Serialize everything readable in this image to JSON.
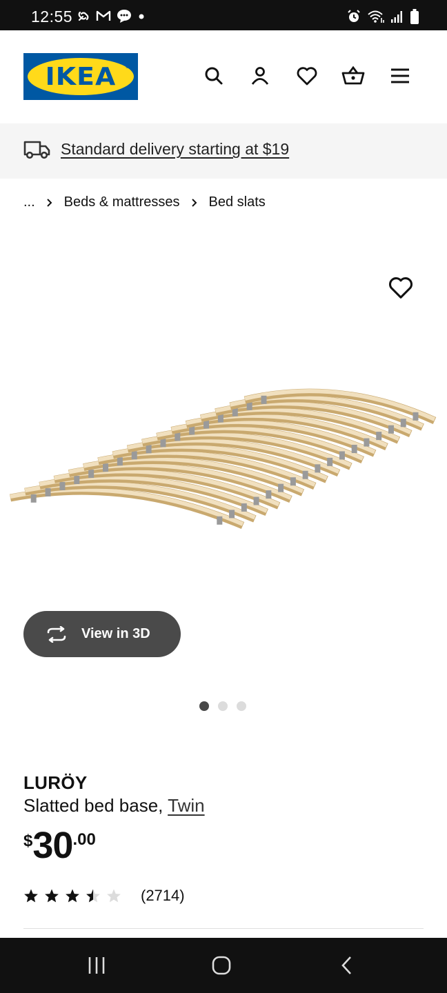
{
  "status_bar": {
    "time": "12:55",
    "left_icons": [
      "link-icon",
      "gmail-icon",
      "chat-icon",
      "dot-icon"
    ],
    "right_icons": [
      "alarm-icon",
      "wifi-icon",
      "signal-icon",
      "battery-icon"
    ]
  },
  "header": {
    "logo_text": "IKEA",
    "logo_colors": {
      "blue": "#0058a3",
      "yellow": "#ffda1a"
    },
    "icons": [
      "search-icon",
      "account-icon",
      "heart-icon",
      "basket-icon",
      "menu-icon"
    ]
  },
  "delivery": {
    "text": "Standard delivery starting at $19",
    "icon": "truck-icon"
  },
  "breadcrumb": {
    "items": [
      "...",
      "Beds & mattresses",
      "Bed slats"
    ]
  },
  "gallery": {
    "view_3d_label": "View in 3D",
    "page_count": 3,
    "active_page": 1
  },
  "product": {
    "name": "LURÖY",
    "description": "Slatted bed base, ",
    "variant": "Twin",
    "price": {
      "currency": "$",
      "integer": "30",
      "decimal": ".00"
    },
    "rating": {
      "value": 3.5,
      "max": 5,
      "count_label": "(2714)"
    }
  },
  "nav_bar": {
    "buttons": [
      "recents-icon",
      "home-icon",
      "back-icon"
    ]
  }
}
